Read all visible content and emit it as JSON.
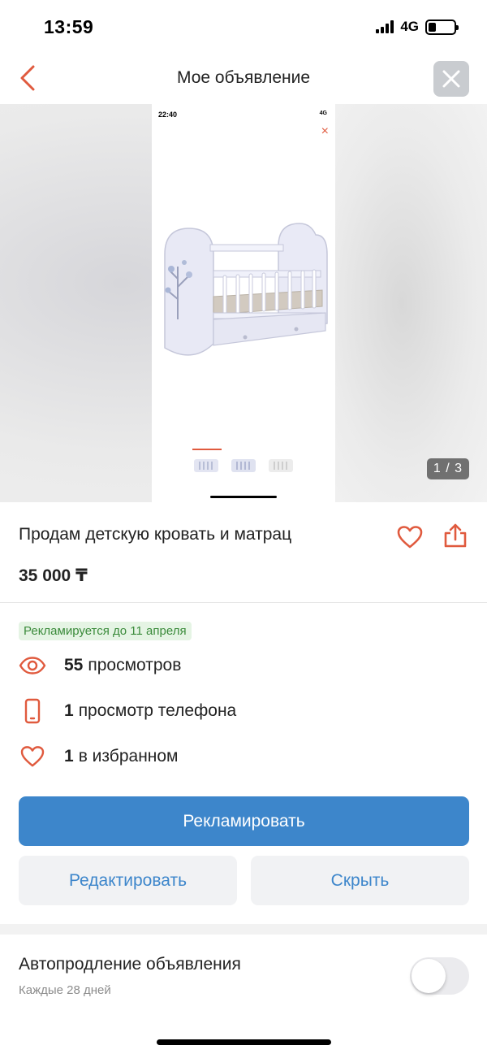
{
  "status_bar": {
    "time": "13:59",
    "network": "4G"
  },
  "nav": {
    "title": "Мое объявление",
    "back_icon": "chevron-left-icon",
    "close_icon": "close-icon"
  },
  "gallery": {
    "counter": "1 / 3",
    "screenshot": {
      "time": "22:40",
      "status": "4G",
      "close_glyph": "×"
    }
  },
  "ad": {
    "title": "Продам детскую кровать и матрац",
    "price": "35 000 ₸"
  },
  "promo_badge": "Рекламируется до 11 апреля",
  "stats": [
    {
      "icon": "eye-icon",
      "count": "55",
      "label": "просмотров"
    },
    {
      "icon": "phone-icon",
      "count": "1",
      "label": "просмотр телефона"
    },
    {
      "icon": "heart-icon",
      "count": "1",
      "label": "в избранном"
    }
  ],
  "buttons": {
    "promote": "Рекламировать",
    "edit": "Редактировать",
    "hide": "Скрыть"
  },
  "auto_renew": {
    "title": "Автопродление объявления",
    "subtitle": "Каждые 28 дней",
    "enabled": false
  },
  "colors": {
    "accent": "#e05a3e",
    "primary": "#3d86cb",
    "promo_bg": "#e5f4e4",
    "promo_text": "#3b8b3b"
  }
}
